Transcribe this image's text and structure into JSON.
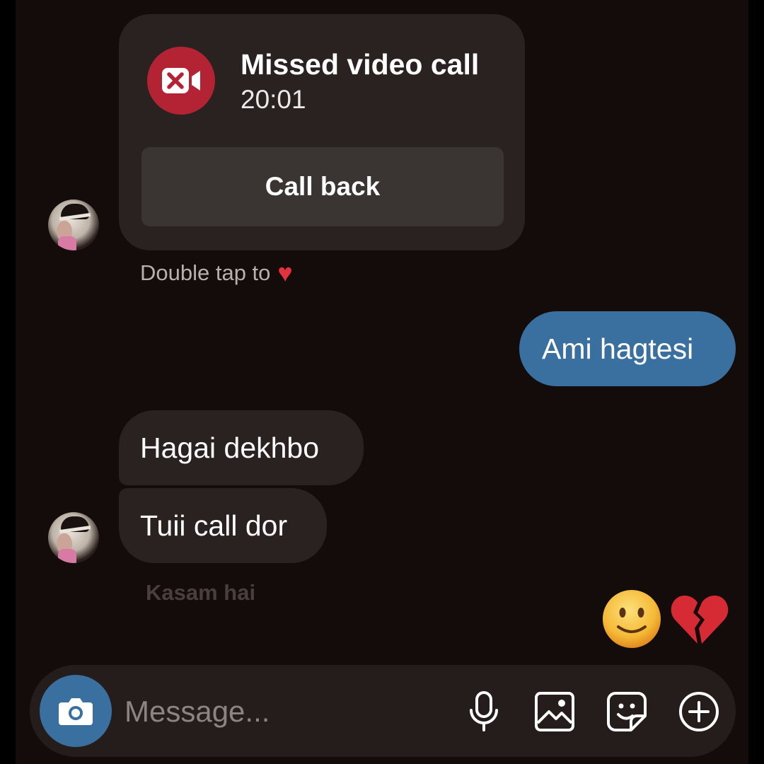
{
  "missed_call": {
    "title": "Missed video call",
    "time": "20:01",
    "callback_label": "Call back",
    "icon": "video-off-icon",
    "icon_color": "#b32333"
  },
  "reaction_hint": {
    "text": "Double tap to",
    "icon": "heart"
  },
  "messages": [
    {
      "direction": "sent",
      "text": "Ami hagtesi"
    },
    {
      "direction": "received",
      "text": "Hagai dekhbo"
    },
    {
      "direction": "received",
      "text": "Tuii call dor"
    }
  ],
  "seen_status": "Kasam hai",
  "reactions": [
    "slightly-smiling-face",
    "broken-heart"
  ],
  "composer": {
    "placeholder": "Message...",
    "icons": [
      "camera-icon",
      "microphone-icon",
      "gallery-icon",
      "sticker-icon",
      "plus-circle-icon"
    ]
  },
  "colors": {
    "background": "#130c0b",
    "received_bubble": "#2a2220",
    "sent_bubble": "#3a70a0",
    "accent": "#3a70a0"
  }
}
